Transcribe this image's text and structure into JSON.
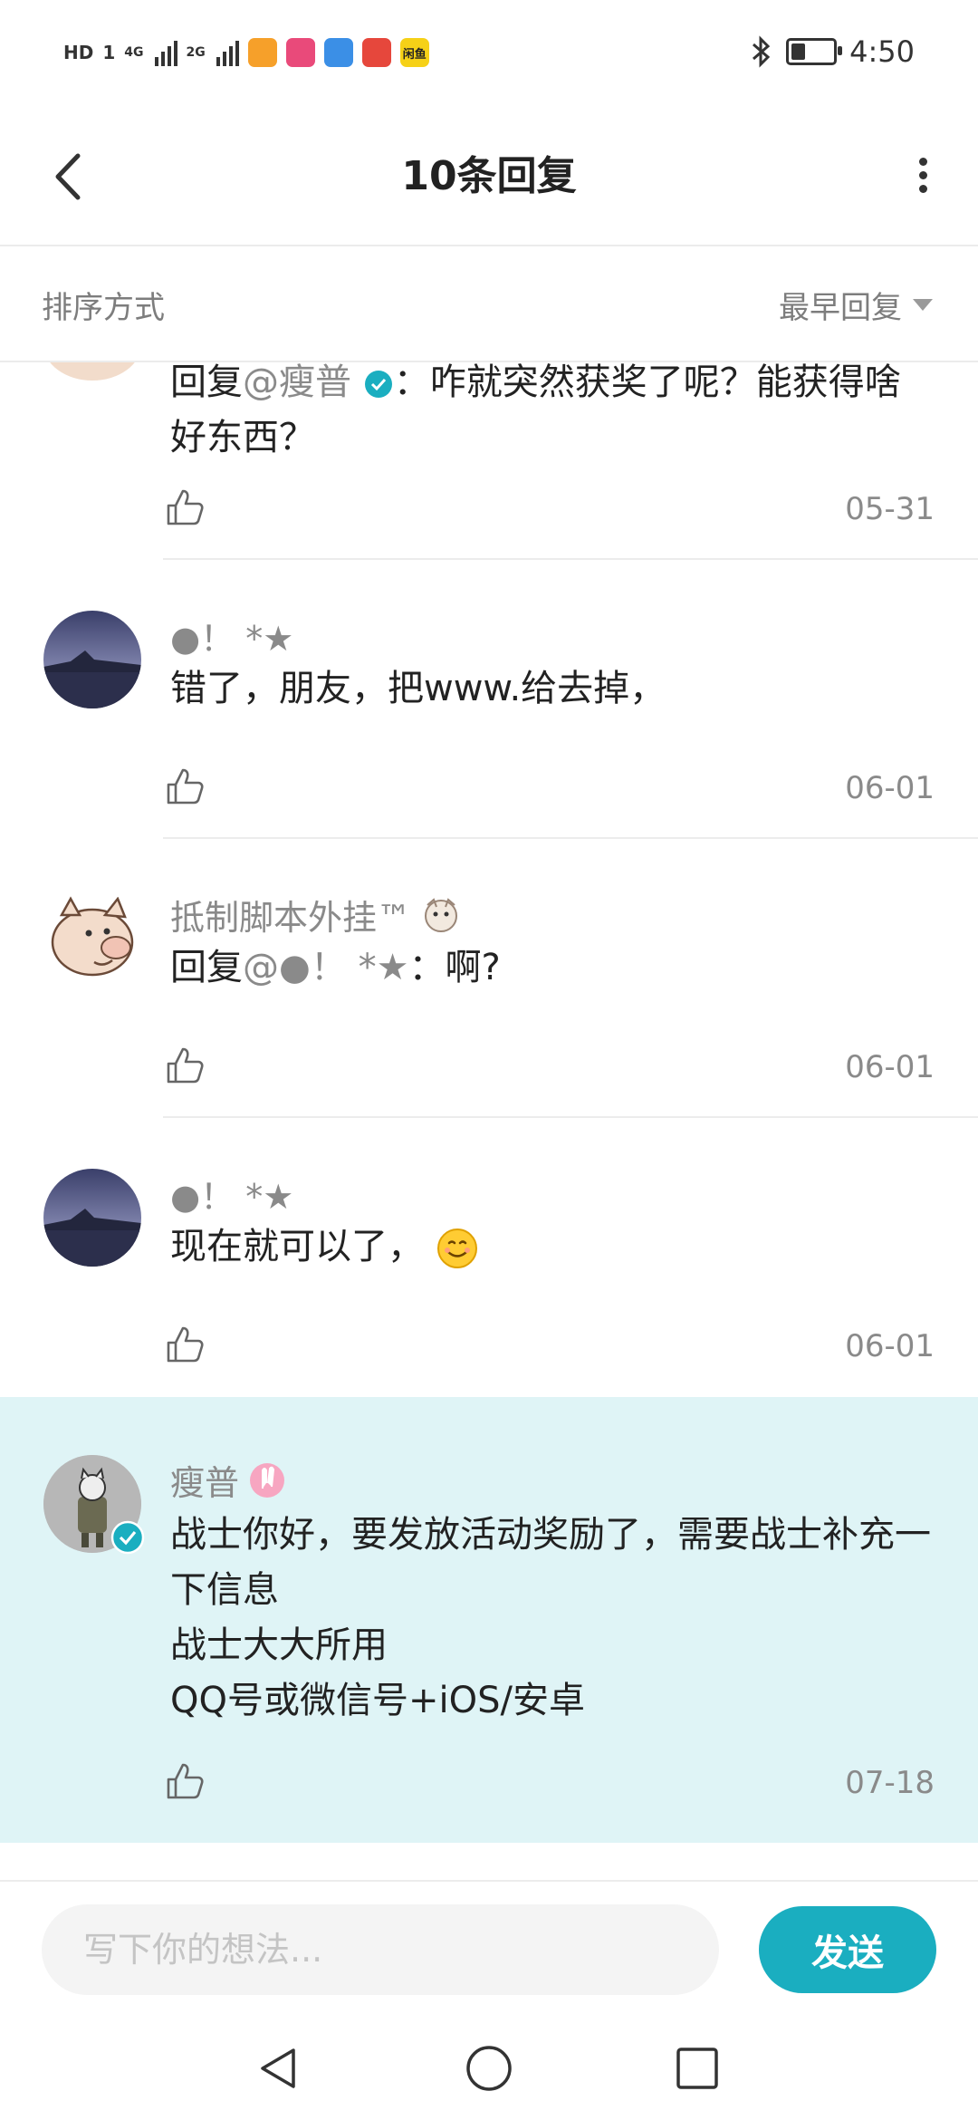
{
  "status_bar": {
    "hd_label": "HD",
    "sim_label": "1",
    "net1": "4G",
    "net2": "2G",
    "time": "4:50",
    "battery_level": 0.35,
    "app_icon_colors": [
      "#f6a02a",
      "#e94a7a",
      "#3b8fe6",
      "#e6473c",
      "#f6d117"
    ],
    "last_app_label": "闲鱼"
  },
  "header": {
    "title": "10条回复",
    "back_icon": "chevron-left-icon",
    "more_icon": "more-vertical-icon"
  },
  "sort": {
    "label": "排序方式",
    "value": "最早回复"
  },
  "comments": [
    {
      "reply_prefix": "回复",
      "mention": "@瘦普",
      "text_after": "：咋就突然获奖了呢？能获得啥好东西？",
      "date": "05-31"
    },
    {
      "name": "●！ *★",
      "text": "错了，朋友，把www.给去掉，",
      "date": "06-01"
    },
    {
      "name": "抵制脚本外挂™",
      "reply_prefix": "回复",
      "mention": "@●！ *★",
      "text_after": "：啊?",
      "date": "06-01"
    },
    {
      "name": "●！ *★",
      "text": "现在就可以了，",
      "date": "06-01"
    },
    {
      "name": "瘦普",
      "lines": [
        "战士你好，要发放活动奖励了，需要战士补充一下信息",
        "战士大大所用",
        "QQ号或微信号+iOS/安卓"
      ],
      "date": "07-18"
    }
  ],
  "input": {
    "placeholder": "写下你的想法...",
    "send_label": "发送"
  },
  "colors": {
    "accent": "#1aaec0",
    "highlight_bg": "#dff4f6"
  }
}
